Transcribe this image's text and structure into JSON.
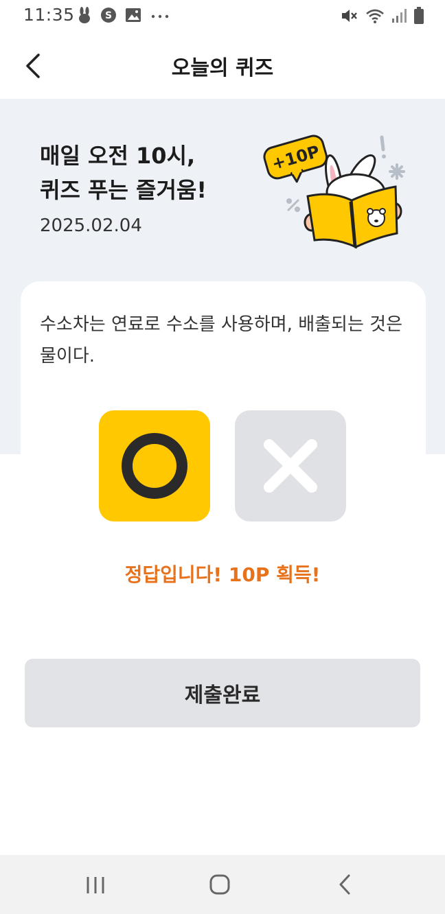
{
  "status_bar": {
    "time": "11:35",
    "left_icons": [
      "rabbit-icon",
      "s-coin-icon",
      "image-icon",
      "more-icon"
    ],
    "right_icons": [
      "mute-icon",
      "wifi-icon",
      "signal-icon",
      "battery-icon"
    ]
  },
  "header": {
    "title": "오늘의 퀴즈",
    "back_icon": "chevron-left-icon"
  },
  "hero": {
    "title": "매일 오전 10시,\n퀴즈 푸는 즐거움!",
    "date": "2025.02.04",
    "badge": "+10P"
  },
  "quiz": {
    "question": "수소차는 연료로 수소를 사용하며, 배출되는 것은 물이다.",
    "choices": [
      {
        "symbol": "O",
        "selected": true,
        "color": "#ffc800"
      },
      {
        "symbol": "X",
        "selected": false,
        "color": "#dfe1e5"
      }
    ],
    "result": "정답입니다! 10P 획득!",
    "result_color": "#e8721c"
  },
  "submit": {
    "label": "제출완료"
  },
  "nav_bar": {
    "icons": [
      "recent-apps-icon",
      "home-icon",
      "back-icon"
    ]
  }
}
